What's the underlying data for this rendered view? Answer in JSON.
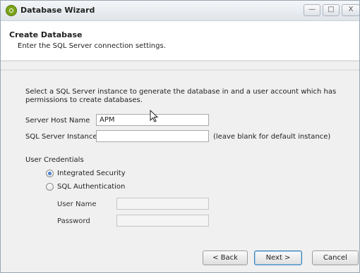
{
  "window": {
    "title": "Database Wizard"
  },
  "header": {
    "title": "Create Database",
    "subtitle": "Enter the SQL Server connection settings."
  },
  "description": "Select a SQL Server instance to generate the database in and a user account which has permissions to create databases.",
  "server_host": {
    "label": "Server Host Name",
    "value": "APM"
  },
  "sql_instance": {
    "label": "SQL Server Instance",
    "value": "",
    "hint": "(leave blank for default instance)"
  },
  "credentials": {
    "heading": "User Credentials",
    "options": [
      "Integrated Security",
      "SQL Authentication"
    ],
    "selected": "Integrated Security",
    "user_name_label": "User Name",
    "password_label": "Password",
    "user_name_value": "",
    "password_value": ""
  },
  "buttons": {
    "back": "< Back",
    "next": "Next >",
    "cancel": "Cancel"
  },
  "titlebar_buttons": {
    "minimize": "—",
    "maximize": "□",
    "close": "X"
  }
}
